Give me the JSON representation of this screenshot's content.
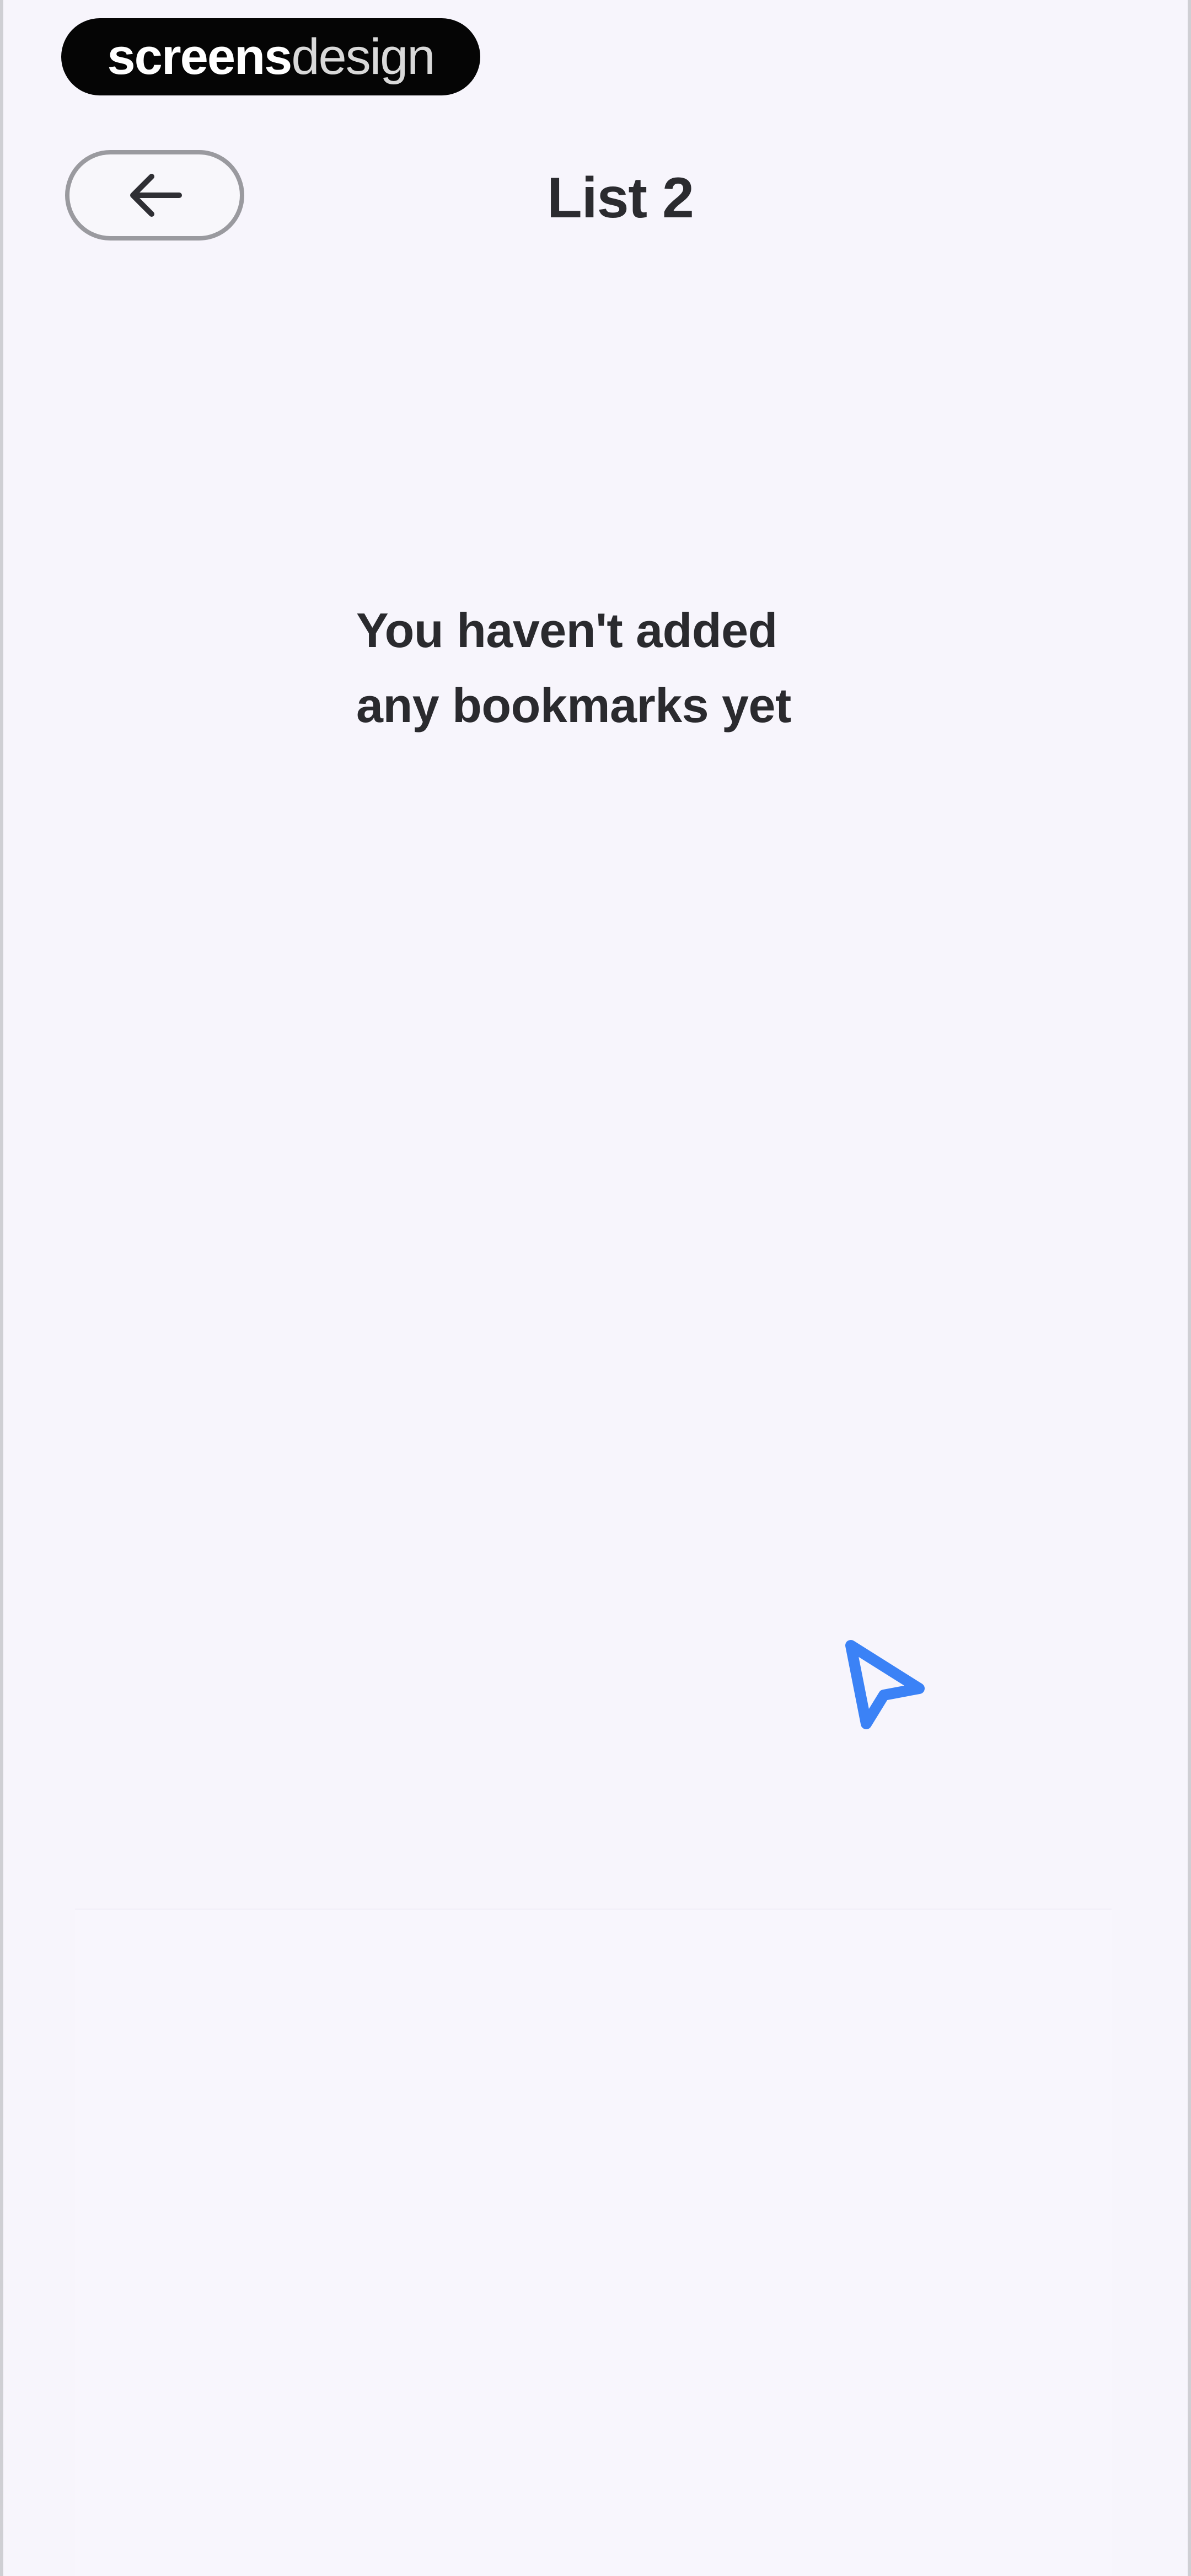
{
  "brand": {
    "name_strong": "screens",
    "name_light": "design"
  },
  "header": {
    "back_icon": "arrow-left-icon",
    "title": "List 2"
  },
  "empty_state": {
    "line1": "You haven't added",
    "line2": "any bookmarks yet"
  },
  "overlay": {
    "cursor_icon": "pointer-arrow-icon",
    "cursor_color": "#3b82f6"
  },
  "colors": {
    "background": "#f7f5fc",
    "text": "#2b2b2f",
    "badge": "#050505"
  }
}
